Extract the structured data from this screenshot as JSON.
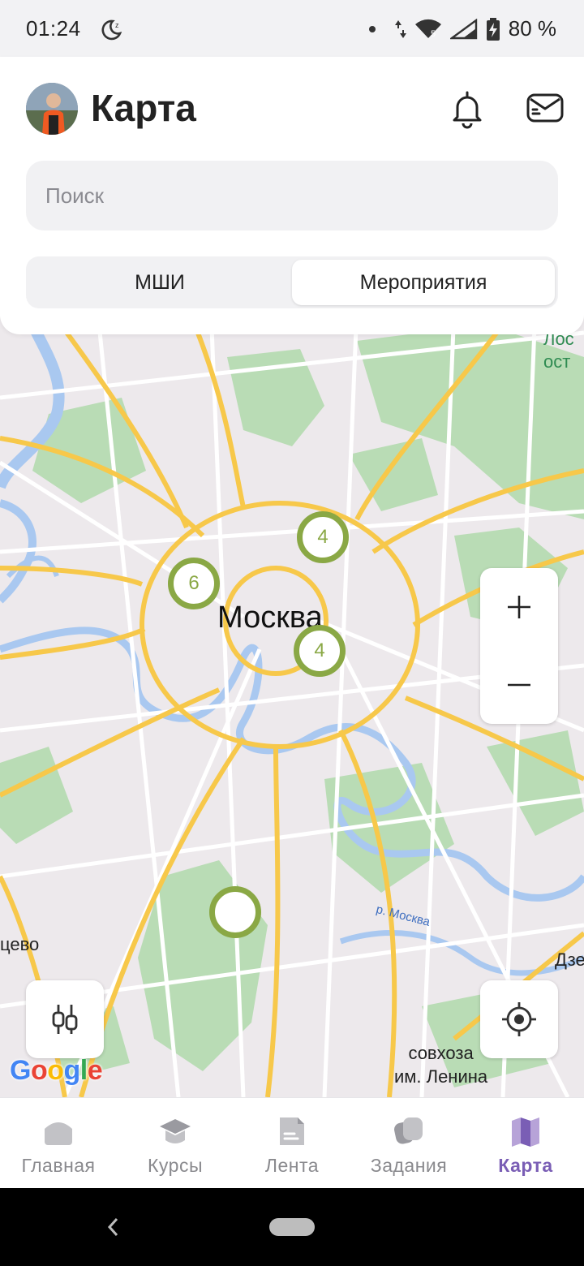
{
  "status_bar": {
    "time": "01:24",
    "battery": "80 %",
    "network_badge": "5",
    "icons": [
      "moon-icon",
      "data-arrows-icon",
      "wifi-icon",
      "signal-icon",
      "battery-charging-icon"
    ]
  },
  "header": {
    "title": "Карта",
    "bell_icon": "bell-icon",
    "messages_icon": "messages-icon"
  },
  "search": {
    "placeholder": "Поиск",
    "value": ""
  },
  "segments": {
    "items": [
      "МШИ",
      "Мероприятия"
    ],
    "selected": "Мероприятия"
  },
  "map": {
    "city_label": "Москва",
    "park_label_lines": [
      "Лос",
      "ост"
    ],
    "river_label": "р. Москва",
    "place_left": "цево",
    "place_right": "Дзе",
    "place_south_lines": [
      "совхоза",
      "им. Ленина"
    ],
    "clusters": [
      {
        "count": "4"
      },
      {
        "count": "6"
      },
      {
        "count": "4"
      },
      {
        "count": ""
      }
    ],
    "attribution": "Google",
    "zoom_in_icon": "plus-icon",
    "zoom_out_icon": "minus-icon",
    "filter_icon": "sliders-icon",
    "locate_icon": "crosshair-icon"
  },
  "tabs": [
    {
      "label": "Главная",
      "icon": "home-icon",
      "active": false
    },
    {
      "label": "Курсы",
      "icon": "graduation-cap-icon",
      "active": false
    },
    {
      "label": "Лента",
      "icon": "document-icon",
      "active": false
    },
    {
      "label": "Задания",
      "icon": "cards-icon",
      "active": false
    },
    {
      "label": "Карта",
      "icon": "map-icon",
      "active": true
    }
  ],
  "colors": {
    "accent": "#7a5eb5",
    "cluster": "#8aa845",
    "map_background": "#ede9ec",
    "road": "#f7c84a",
    "water": "#a9c8f0",
    "park": "#b9dcb5"
  }
}
